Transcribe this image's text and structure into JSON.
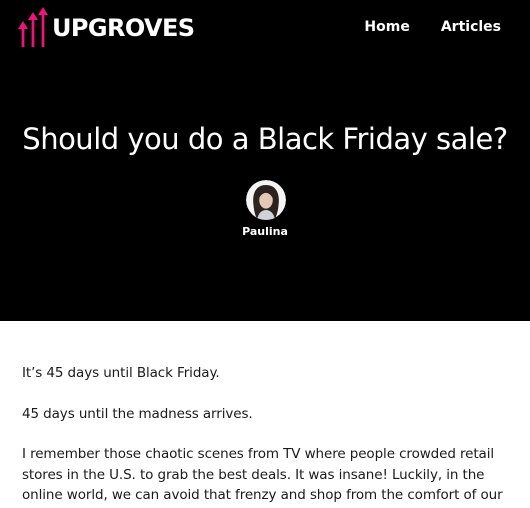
{
  "header": {
    "brand": "UPGROVES",
    "brand_icon": "arrows-up-logo-icon",
    "nav": [
      {
        "label": "Home"
      },
      {
        "label": "Articles"
      }
    ]
  },
  "post": {
    "title": "Should you do a Black Friday sale?",
    "author": "Paulina",
    "paragraphs": [
      "It’s 45 days until Black Friday.",
      "45 days until the madness arrives.",
      "I remember those chaotic scenes from TV where people crowded retail stores in the U.S. to grab the best deals. It was insane! Luckily, in the online world, we can avoid that frenzy and shop from the comfort of our"
    ]
  },
  "colors": {
    "hero_background": "#000000",
    "brand_accent": "#e8157a",
    "text_on_dark": "#ffffff",
    "body_text": "#1a1a1a"
  }
}
